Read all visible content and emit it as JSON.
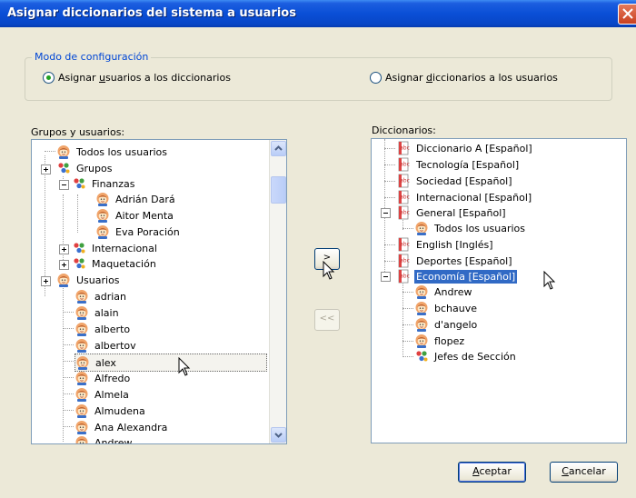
{
  "window": {
    "title": "Asignar diccionarios del sistema a usuarios"
  },
  "config_group": {
    "label": "Modo de configuración",
    "option_users": {
      "prefix": "Asignar ",
      "accel": "u",
      "suffix": "suarios a los diccionarios",
      "checked": true
    },
    "option_dicts": {
      "prefix": "Asignar ",
      "accel": "d",
      "suffix": "iccionarios a los usuarios",
      "checked": false
    }
  },
  "left_panel": {
    "label": "Grupos y usuarios:",
    "items": [
      {
        "label": "Todos los usuarios",
        "icon": "user-icon"
      },
      {
        "label": "Grupos",
        "icon": "group-icon"
      },
      {
        "label": "Finanzas",
        "icon": "group-icon"
      },
      {
        "label": "Adrián Dará",
        "icon": "user-icon"
      },
      {
        "label": "Aitor Menta",
        "icon": "user-icon"
      },
      {
        "label": "Eva Poración",
        "icon": "user-icon"
      },
      {
        "label": "Internacional",
        "icon": "group-icon"
      },
      {
        "label": "Maquetación",
        "icon": "group-icon"
      },
      {
        "label": "Usuarios",
        "icon": "user-icon"
      },
      {
        "label": "adrian",
        "icon": "user-icon"
      },
      {
        "label": "alain",
        "icon": "user-icon"
      },
      {
        "label": "alberto",
        "icon": "user-icon"
      },
      {
        "label": "albertov",
        "icon": "user-icon"
      },
      {
        "label": "alex",
        "icon": "user-icon",
        "selected": true
      },
      {
        "label": "Alfredo",
        "icon": "user-icon"
      },
      {
        "label": "Almela",
        "icon": "user-icon"
      },
      {
        "label": "Almudena",
        "icon": "user-icon"
      },
      {
        "label": "Ana Alexandra",
        "icon": "user-icon"
      },
      {
        "label": "Andrew",
        "icon": "user-icon"
      }
    ]
  },
  "right_panel": {
    "label": "Diccionarios:",
    "items": [
      {
        "label": "Diccionario A [Español]",
        "icon": "dictionary-icon"
      },
      {
        "label": "Tecnología [Español]",
        "icon": "dictionary-icon"
      },
      {
        "label": "Sociedad [Español]",
        "icon": "dictionary-icon"
      },
      {
        "label": "Internacional [Español]",
        "icon": "dictionary-icon"
      },
      {
        "label": "General [Español]",
        "icon": "dictionary-icon"
      },
      {
        "label": "Todos los usuarios",
        "icon": "user-icon"
      },
      {
        "label": "English [Inglés]",
        "icon": "dictionary-icon"
      },
      {
        "label": "Deportes [Español]",
        "icon": "dictionary-icon"
      },
      {
        "label": "Economía [Español]",
        "icon": "dictionary-icon",
        "highlighted": true
      },
      {
        "label": "Andrew",
        "icon": "user-icon"
      },
      {
        "label": "bchauve",
        "icon": "user-icon"
      },
      {
        "label": "d'angelo",
        "icon": "user-icon"
      },
      {
        "label": "flopez",
        "icon": "user-icon"
      },
      {
        "label": "Jefes de Sección",
        "icon": "group-icon"
      }
    ]
  },
  "buttons": {
    "add": ">",
    "remove": "<<",
    "accept": {
      "accel": "A",
      "rest": "ceptar"
    },
    "cancel": {
      "accel": "C",
      "rest": "ancelar"
    }
  },
  "colors": {
    "title_bar": "#0a4fd6",
    "selection": "#316ac5",
    "group_label": "#0046d5",
    "window_bg": "#ece9d8"
  }
}
